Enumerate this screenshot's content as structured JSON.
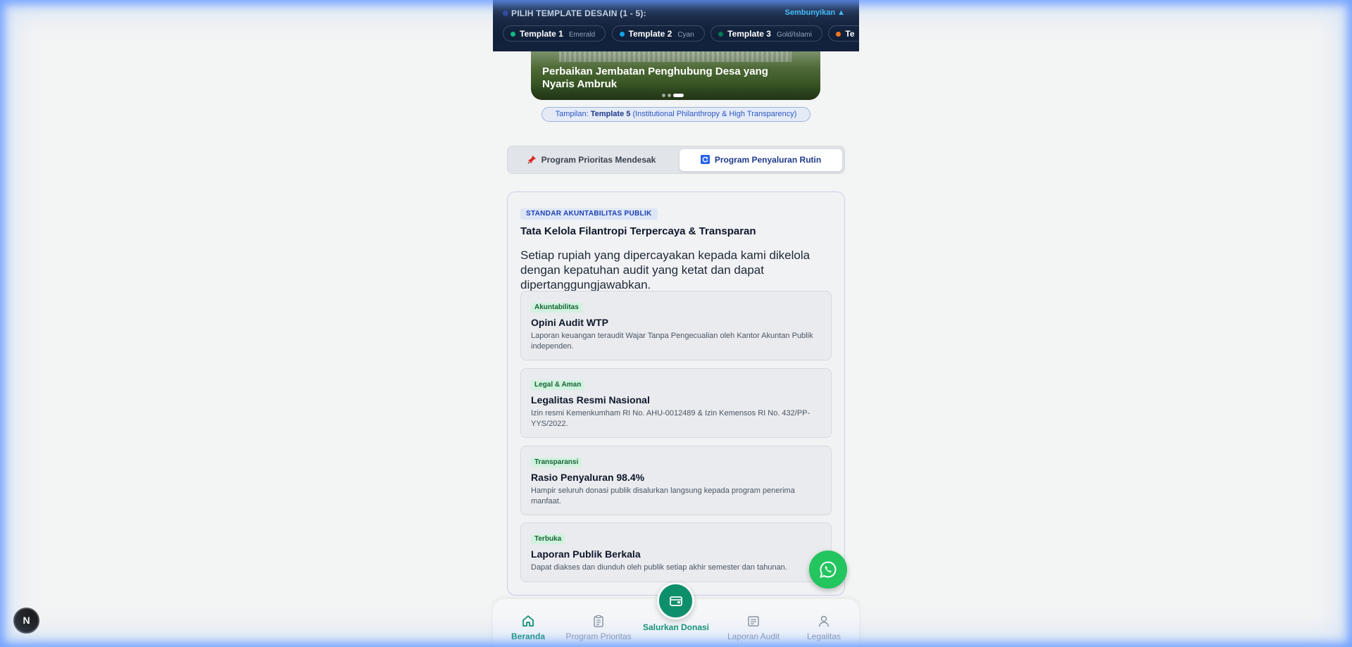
{
  "picker": {
    "title": "PILIH TEMPLATE DESAIN (1 - 5):",
    "hide_label": "Sembunyikan ▲",
    "templates": [
      {
        "name": "Template 1",
        "sub": "Emerald",
        "color": "#10b981"
      },
      {
        "name": "Template 2",
        "sub": "Cyan",
        "color": "#0ea5e9"
      },
      {
        "name": "Template 3",
        "sub": "Gold/Islami",
        "color": "#047857"
      },
      {
        "name": "Te",
        "sub": "",
        "color": "#f97316"
      }
    ]
  },
  "banner": {
    "title": "Perbaikan Jembatan Penghubung Desa yang Nyaris Ambruk"
  },
  "view_pill": {
    "prefix": "Tampilan: ",
    "name": "Template 5",
    "suffix": " (Institutional Philanthropy & High Transparency)"
  },
  "tabs": [
    {
      "label": "Program Prioritas Mendesak",
      "icon": "pin-icon",
      "active": false
    },
    {
      "label": "Program Penyaluran Rutin",
      "icon": "refresh-icon",
      "active": true
    }
  ],
  "card": {
    "badge": "STANDAR AKUNTABILITAS PUBLIK",
    "title": "Tata Kelola Filantropi Terpercaya & Transparan",
    "description": "Setiap rupiah yang dipercayakan kepada kami dikelola dengan kepatuhan audit yang ketat dan dapat dipertanggungjawabkan.",
    "items": [
      {
        "tag": "Akuntabilitas",
        "title": "Opini Audit WTP",
        "desc": "Laporan keuangan teraudit Wajar Tanpa Pengecualian oleh Kantor Akuntan Publik independen."
      },
      {
        "tag": "Legal & Aman",
        "title": "Legalitas Resmi Nasional",
        "desc": "Izin resmi Kemenkumham RI No. AHU-0012489 & Izin Kemensos RI No. 432/PP-YYS/2022."
      },
      {
        "tag": "Transparansi",
        "title": "Rasio Penyaluran 98.4%",
        "desc": "Hampir seluruh donasi publik disalurkan langsung kepada program penerima manfaat."
      },
      {
        "tag": "Terbuka",
        "title": "Laporan Publik Berkala",
        "desc": "Dapat diakses dan diunduh oleh publik setiap akhir semester dan tahunan."
      }
    ]
  },
  "nav": {
    "items": [
      {
        "label": "Beranda",
        "icon": "home-icon",
        "active": true
      },
      {
        "label": "Program Prioritas",
        "icon": "clipboard-icon",
        "active": false
      },
      {
        "label": "Laporan Audit",
        "icon": "report-icon",
        "active": false
      },
      {
        "label": "Legalitas",
        "icon": "user-icon",
        "active": false
      }
    ],
    "donate_label": "Salurkan Donasi"
  },
  "next_badge": "N",
  "colors": {
    "primary": "#0e8f6c",
    "navy": "#1e3a8a",
    "whatsapp": "#22c55e"
  }
}
